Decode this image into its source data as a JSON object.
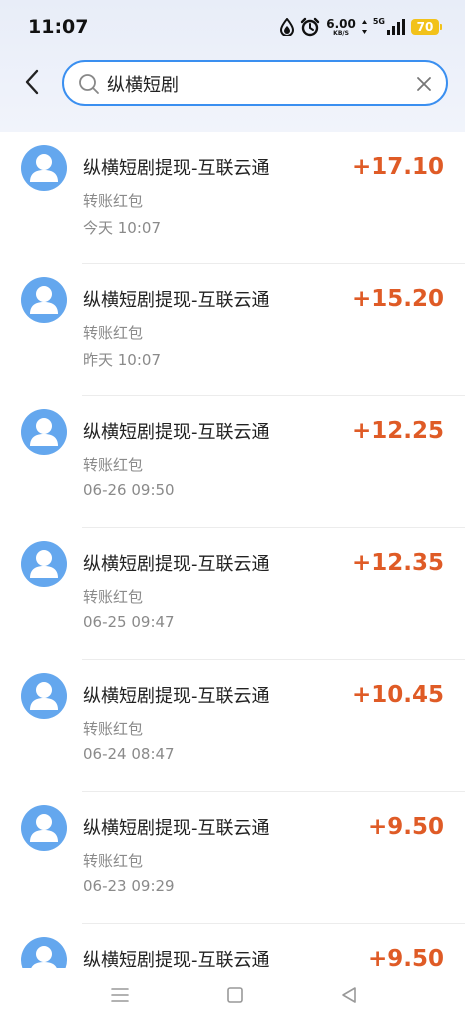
{
  "status": {
    "time": "11:07",
    "net_speed": "6.00",
    "net_unit": "KB/S",
    "net_type": "5G",
    "battery": "70"
  },
  "search": {
    "query": "纵横短剧"
  },
  "transactions": [
    {
      "title": "纵横短剧提现-互联云通",
      "type": "转账红包",
      "time": "今天 10:07",
      "amount": "+17.10"
    },
    {
      "title": "纵横短剧提现-互联云通",
      "type": "转账红包",
      "time": "昨天 10:07",
      "amount": "+15.20"
    },
    {
      "title": "纵横短剧提现-互联云通",
      "type": "转账红包",
      "time": "06-26 09:50",
      "amount": "+12.25"
    },
    {
      "title": "纵横短剧提现-互联云通",
      "type": "转账红包",
      "time": "06-25 09:47",
      "amount": "+12.35"
    },
    {
      "title": "纵横短剧提现-互联云通",
      "type": "转账红包",
      "time": "06-24 08:47",
      "amount": "+10.45"
    },
    {
      "title": "纵横短剧提现-互联云通",
      "type": "转账红包",
      "time": "06-23 09:29",
      "amount": "+9.50"
    },
    {
      "title": "纵横短剧提现-互联云通",
      "type": "",
      "time": "",
      "amount": "+9.50"
    }
  ],
  "colors": {
    "accent": "#3a8ff0",
    "amount": "#df5b26",
    "avatar": "#64a7ee"
  },
  "icons": {
    "back": "chevron-left-icon",
    "search": "search-icon",
    "clear": "close-icon",
    "avatar": "user-icon",
    "nav_menu": "menu-icon",
    "nav_home": "square-icon",
    "nav_back": "triangle-back-icon"
  }
}
